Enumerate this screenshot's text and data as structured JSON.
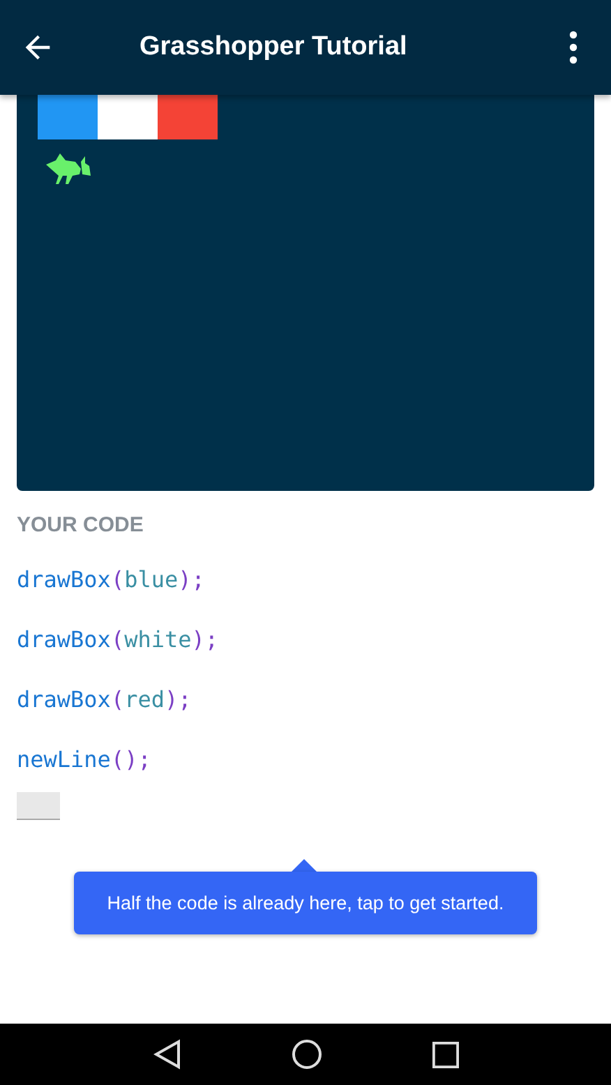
{
  "app_bar": {
    "title": "Grasshopper Tutorial"
  },
  "canvas": {
    "boxes": [
      {
        "color": "#2196f3"
      },
      {
        "color": "#ffffff"
      },
      {
        "color": "#f44336"
      }
    ]
  },
  "code": {
    "heading": "YOUR CODE",
    "lines": [
      {
        "parts": [
          {
            "kind": "function",
            "text": "drawBox"
          },
          {
            "kind": "punct",
            "text": "("
          },
          {
            "kind": "argument",
            "text": "blue"
          },
          {
            "kind": "punct",
            "text": ");"
          }
        ]
      },
      {
        "parts": [
          {
            "kind": "function",
            "text": "drawBox"
          },
          {
            "kind": "punct",
            "text": "("
          },
          {
            "kind": "argument",
            "text": "white"
          },
          {
            "kind": "punct",
            "text": ");"
          }
        ]
      },
      {
        "parts": [
          {
            "kind": "function",
            "text": "drawBox"
          },
          {
            "kind": "punct",
            "text": "("
          },
          {
            "kind": "argument",
            "text": "red"
          },
          {
            "kind": "punct",
            "text": ");"
          }
        ]
      },
      {
        "parts": [
          {
            "kind": "function",
            "text": "newLine"
          },
          {
            "kind": "punct",
            "text": "();"
          }
        ]
      }
    ]
  },
  "tooltip": {
    "text": "Half the code is already here, tap to get started."
  }
}
